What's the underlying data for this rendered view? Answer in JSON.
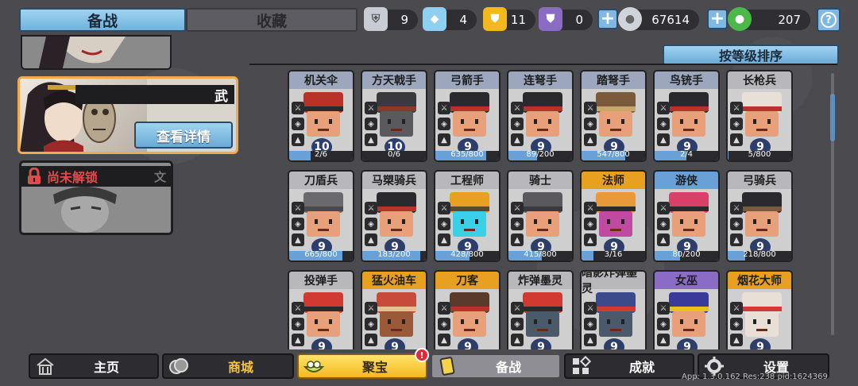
{
  "tabs": {
    "active": "备战",
    "inactive": "收藏"
  },
  "resources": [
    {
      "icon": "silver-shield-icon",
      "value": "9"
    },
    {
      "icon": "blue-crystal-icon",
      "value": "4"
    },
    {
      "icon": "gold-badge-icon",
      "value": "11"
    },
    {
      "icon": "purple-badge-icon",
      "value": "0"
    },
    {
      "icon": "silver-coin-icon",
      "value": "67614"
    },
    {
      "icon": "green-gem-icon",
      "value": "207"
    }
  ],
  "hero": {
    "name": "武",
    "detail_button": "查看详情",
    "locked_label": "尚未解锁",
    "locked_badge": "文"
  },
  "sort_button": "按等级排序",
  "units": [
    {
      "name": "机关伞",
      "level": "10",
      "progress": "2/6"
    },
    {
      "name": "方天戟手",
      "level": "10",
      "progress": "0/6"
    },
    {
      "name": "弓箭手",
      "level": "9",
      "progress": "635/800"
    },
    {
      "name": "连弩手",
      "level": "9",
      "progress": "89/200"
    },
    {
      "name": "踏弩手",
      "level": "9",
      "progress": "547/800"
    },
    {
      "name": "鸟铳手",
      "level": "9",
      "progress": "2/4"
    },
    {
      "name": "长枪兵",
      "level": "9",
      "progress": "5/800"
    },
    {
      "name": "刀盾兵",
      "level": "9",
      "progress": "665/800"
    },
    {
      "name": "马槊骑兵",
      "level": "9",
      "progress": "183/200"
    },
    {
      "name": "工程师",
      "level": "9",
      "progress": "428/800"
    },
    {
      "name": "骑士",
      "level": "9",
      "progress": "415/800"
    },
    {
      "name": "法师",
      "level": "9",
      "progress": "3/16"
    },
    {
      "name": "游侠",
      "level": "9",
      "progress": "80/200"
    },
    {
      "name": "弓骑兵",
      "level": "9",
      "progress": "218/800"
    },
    {
      "name": "投弹手",
      "level": "9",
      "progress": ""
    },
    {
      "name": "猛火油车",
      "level": "9",
      "progress": ""
    },
    {
      "name": "刀客",
      "level": "9",
      "progress": ""
    },
    {
      "name": "炸弹墨灵",
      "level": "9",
      "progress": ""
    },
    {
      "name": "暗影炸弹墨灵",
      "level": "9",
      "progress": ""
    },
    {
      "name": "女巫",
      "level": "9",
      "progress": ""
    },
    {
      "name": "烟花大师",
      "level": "9",
      "progress": ""
    }
  ],
  "nav": {
    "home": "主页",
    "shop": "商城",
    "treasure": "聚宝",
    "prepare": "备战",
    "achievements": "成就",
    "settings": "设置",
    "alert": "!"
  },
  "version": "App: 1.3.0.162 Res:238 pid:1624369"
}
